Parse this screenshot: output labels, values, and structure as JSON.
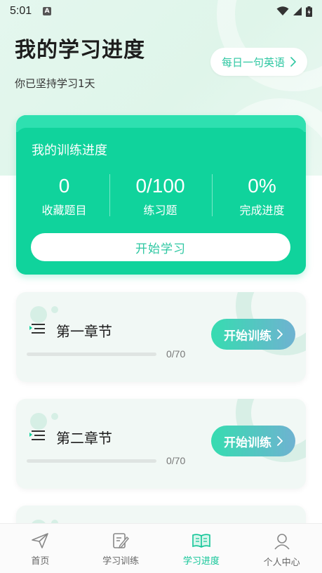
{
  "status_bar": {
    "time": "5:01",
    "notification_badge": "A"
  },
  "header": {
    "title": "我的学习进度",
    "streak": "你已坚持学习1天",
    "english_button": "每日一句英语"
  },
  "progress_card": {
    "title": "我的训练进度",
    "stats": [
      {
        "value": "0",
        "label": "收藏题目"
      },
      {
        "value": "0/100",
        "label": "练习题"
      },
      {
        "value": "0%",
        "label": "完成进度"
      }
    ],
    "start_button": "开始学习"
  },
  "chapters": [
    {
      "title": "第一章节",
      "count": "0/70",
      "progress": 0,
      "button": "开始训练"
    },
    {
      "title": "第二章节",
      "count": "0/70",
      "progress": 0,
      "button": "开始训练"
    }
  ],
  "bottom_nav": {
    "items": [
      {
        "label": "首页",
        "icon": "paper-plane-icon",
        "active": false
      },
      {
        "label": "学习训练",
        "icon": "edit-note-icon",
        "active": false
      },
      {
        "label": "学习进度",
        "icon": "open-book-icon",
        "active": true
      },
      {
        "label": "个人中心",
        "icon": "person-icon",
        "active": false
      }
    ]
  },
  "colors": {
    "accent": "#10d39c",
    "accent_text": "#2ec7a2",
    "nav_active": "#10c597"
  }
}
